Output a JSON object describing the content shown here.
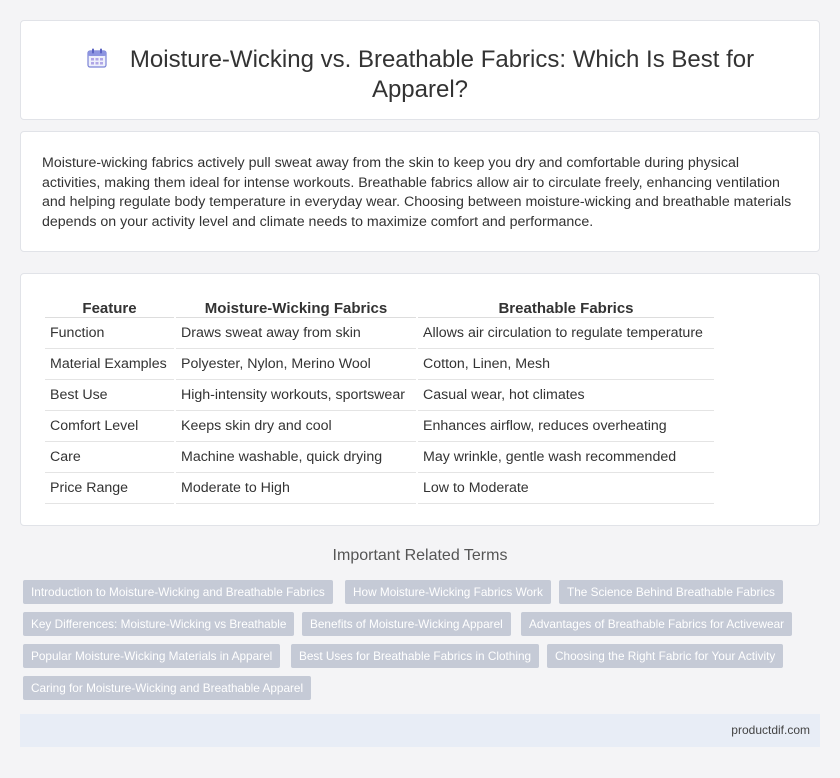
{
  "header": {
    "icon": "calendar-icon",
    "title_line1": "Moisture-Wicking vs. Breathable Fabrics: Which Is Best for",
    "title_line2": "Apparel?"
  },
  "intro": {
    "text": "Moisture-wicking fabrics actively pull sweat away from the skin to keep you dry and comfortable during physical activities, making them ideal for intense workouts. Breathable fabrics allow air to circulate freely, enhancing ventilation and helping regulate body temperature in everyday wear. Choosing between moisture-wicking and breathable materials depends on your activity level and climate needs to maximize comfort and performance."
  },
  "table": {
    "headers": [
      "Feature",
      "Moisture-Wicking Fabrics",
      "Breathable Fabrics"
    ],
    "rows": [
      [
        "Function",
        "Draws sweat away from skin",
        "Allows air circulation to regulate temperature"
      ],
      [
        "Material Examples",
        "Polyester, Nylon, Merino Wool",
        "Cotton, Linen, Mesh"
      ],
      [
        "Best Use",
        "High-intensity workouts, sportswear",
        "Casual wear, hot climates"
      ],
      [
        "Comfort Level",
        "Keeps skin dry and cool",
        "Enhances airflow, reduces overheating"
      ],
      [
        "Care",
        "Machine washable, quick drying",
        "May wrinkle, gentle wash recommended"
      ],
      [
        "Price Range",
        "Moderate to High",
        "Low to Moderate"
      ]
    ]
  },
  "related": {
    "heading": "Important Related Terms",
    "tags": [
      "Introduction to Moisture-Wicking and Breathable Fabrics",
      "How Moisture-Wicking Fabrics Work",
      "The Science Behind Breathable Fabrics",
      "Key Differences: Moisture-Wicking vs Breathable",
      "Benefits of Moisture-Wicking Apparel",
      "Advantages of Breathable Fabrics for Activewear",
      "Popular Moisture-Wicking Materials in Apparel",
      "Best Uses for Breathable Fabrics in Clothing",
      "Choosing the Right Fabric for Your Activity",
      "Caring for Moisture-Wicking and Breathable Apparel"
    ]
  },
  "footer": {
    "site": "productdif.com"
  },
  "colors": {
    "tag_bg": "#c5cad6",
    "footer_bg": "#e8edf6",
    "page_bg": "#f4f4f6"
  }
}
